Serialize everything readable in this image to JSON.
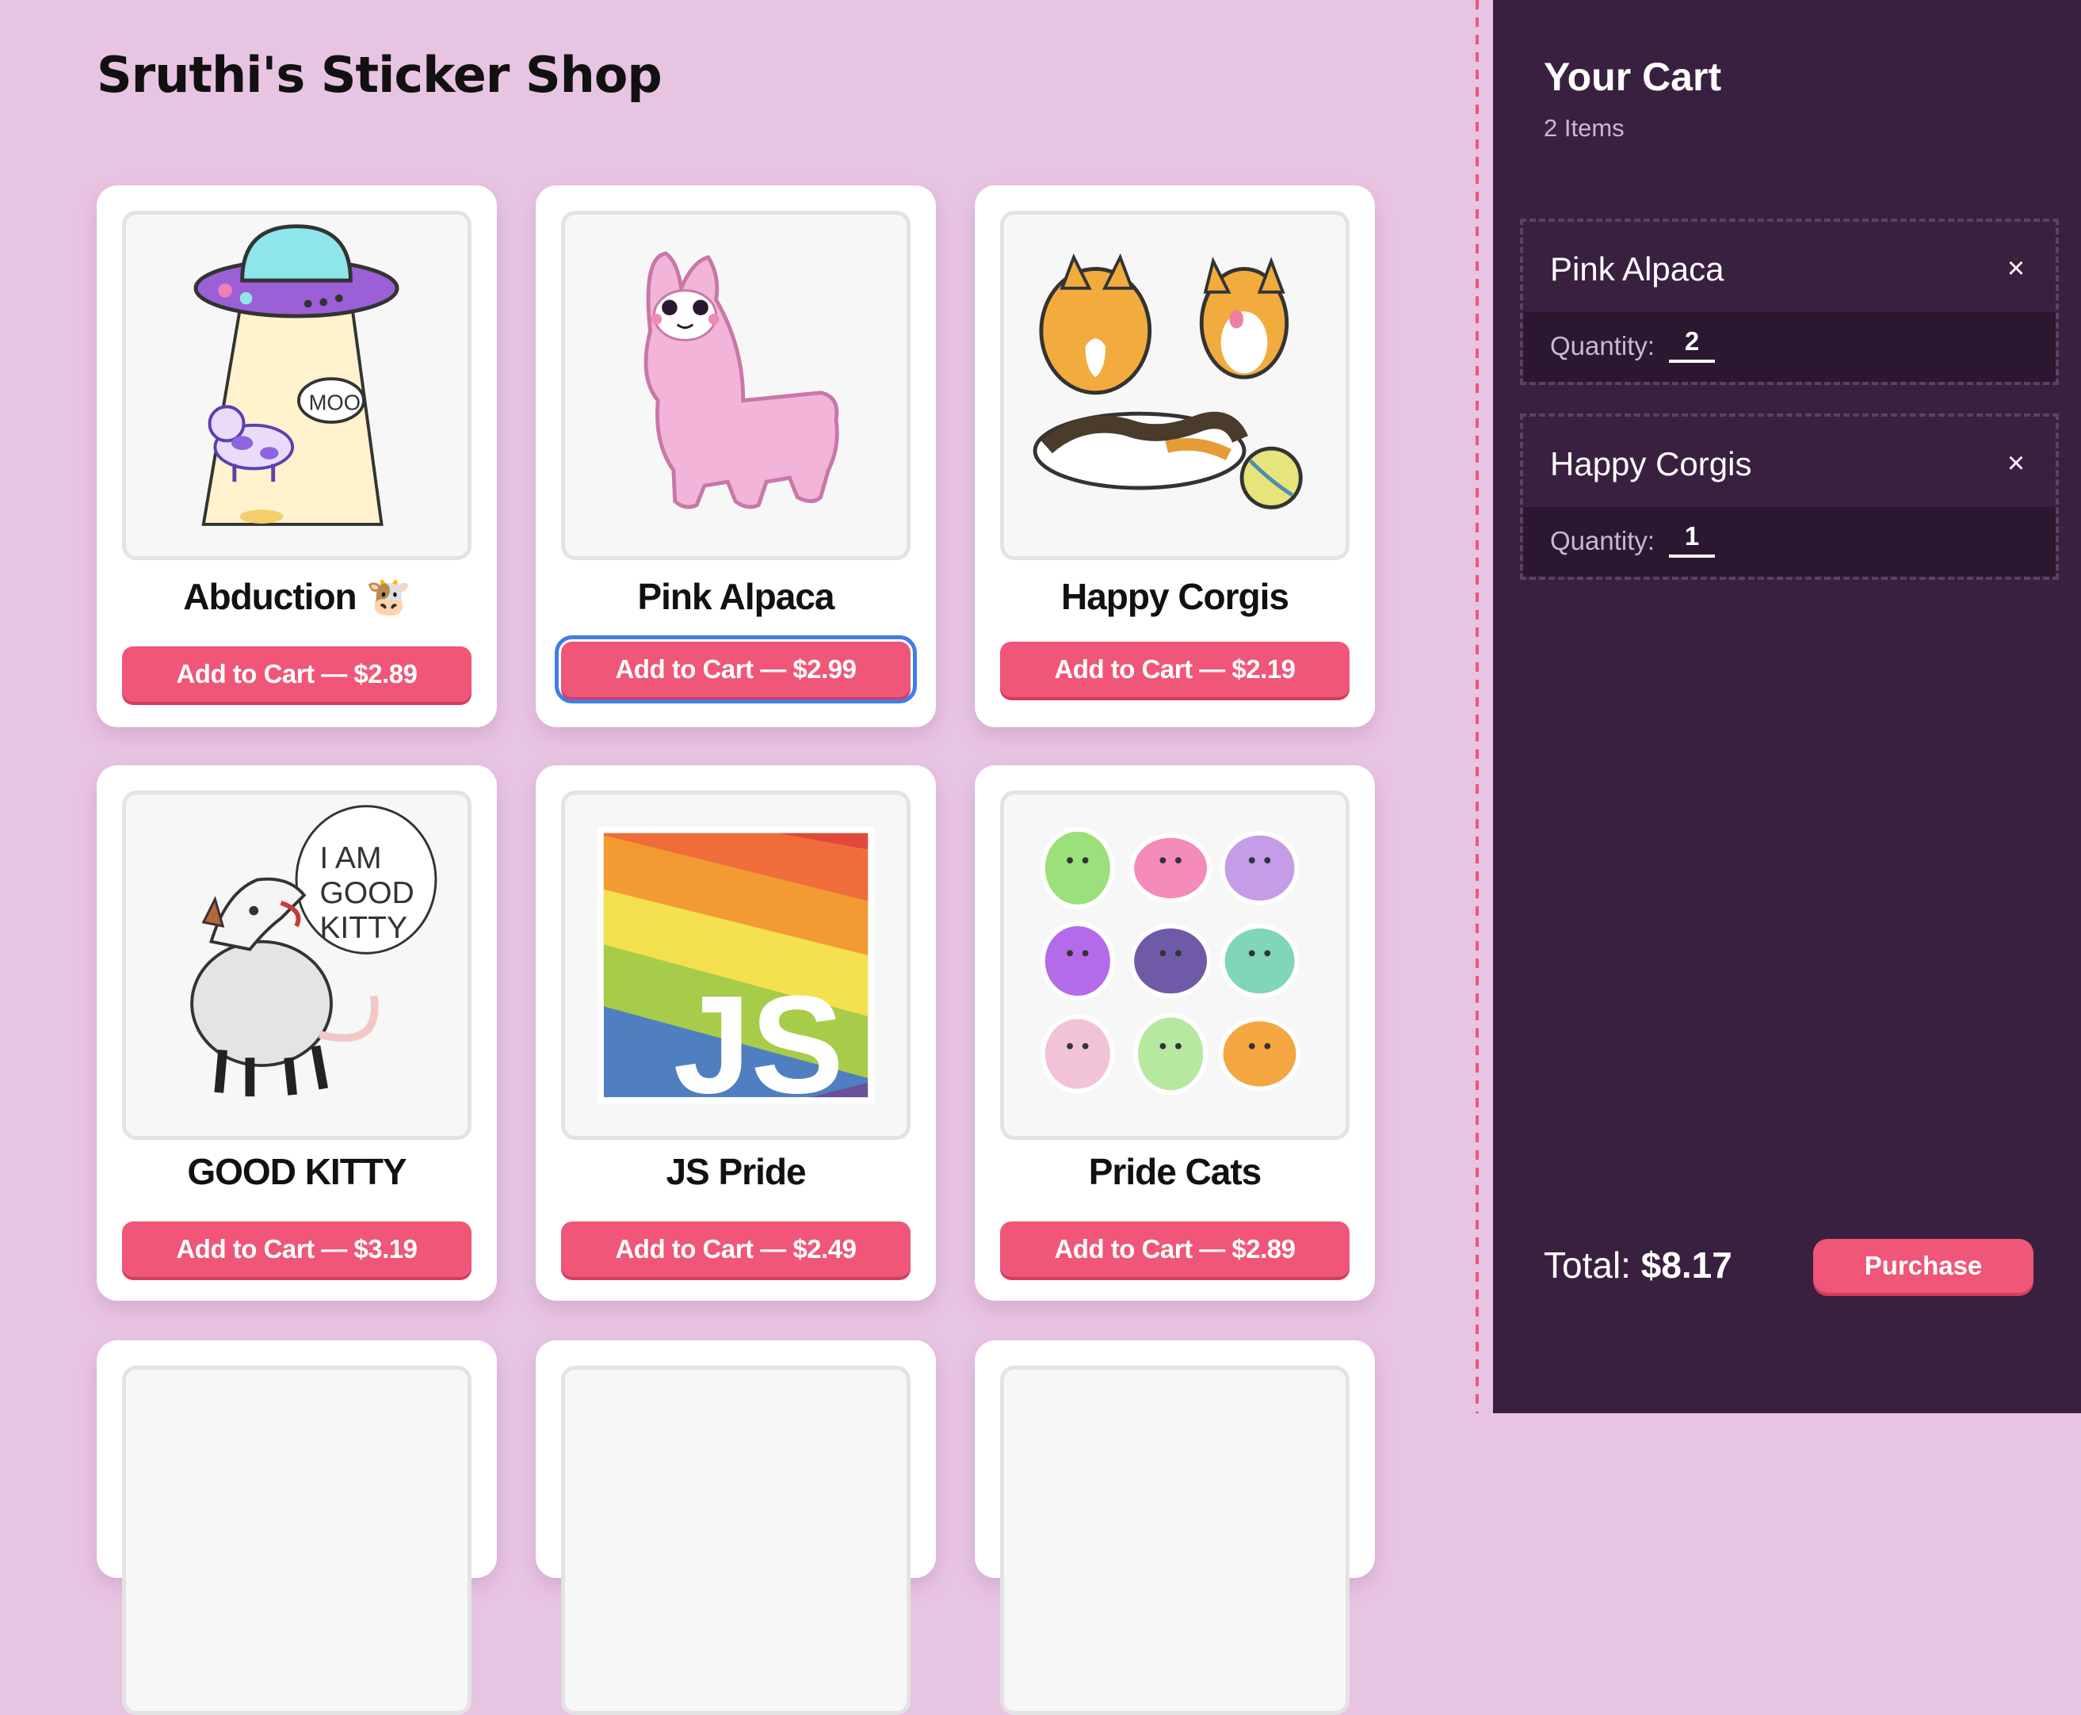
{
  "shop": {
    "title": "Sruthi's Sticker Shop"
  },
  "products": [
    {
      "name": "Abduction 🐮",
      "button": "Add to Cart — $2.89",
      "image": "ufo-cow-sticker"
    },
    {
      "name": "Pink Alpaca",
      "button": "Add to Cart — $2.99",
      "image": "pink-alpaca-sticker",
      "focused": true
    },
    {
      "name": "Happy Corgis",
      "button": "Add to Cart — $2.19",
      "image": "corgis-sticker"
    },
    {
      "name": "GOOD KITTY",
      "button": "Add to Cart — $3.19",
      "image": "opossum-sticker",
      "image_text": [
        "I AM",
        "GOOD",
        "KITTY"
      ]
    },
    {
      "name": "JS Pride",
      "button": "Add to Cart — $2.49",
      "image": "js-rainbow-sticker",
      "image_text": "JS"
    },
    {
      "name": "Pride Cats",
      "button": "Add to Cart — $2.89",
      "image": "pride-cats-sticker"
    }
  ],
  "cart": {
    "title": "Your Cart",
    "count": "2 Items",
    "items": [
      {
        "name": "Pink Alpaca",
        "quantity_label": "Quantity:",
        "quantity": "2",
        "remove": "×"
      },
      {
        "name": "Happy Corgis",
        "quantity_label": "Quantity:",
        "quantity": "1",
        "remove": "×"
      }
    ],
    "total_label": "Total:",
    "total_value": "$8.17",
    "purchase_label": "Purchase"
  },
  "colors": {
    "page_background": "#e8c4e3",
    "accent": "#ef5677",
    "cart_background": "#3a2040",
    "focus_ring": "#3f7ee8"
  }
}
